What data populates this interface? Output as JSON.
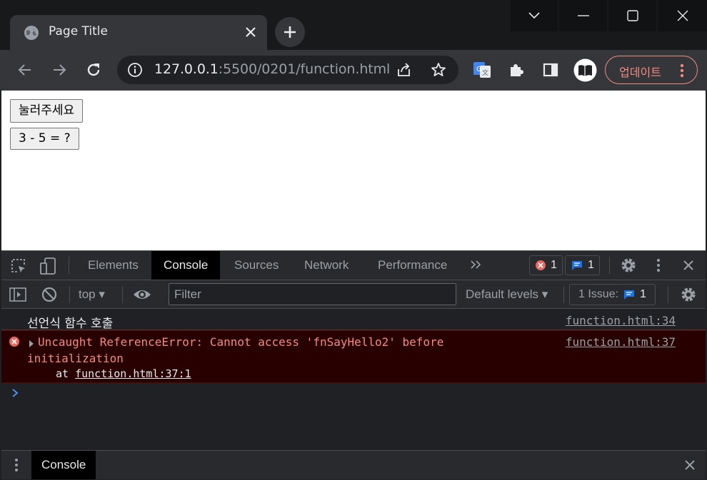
{
  "browser": {
    "tab_title": "Page Title",
    "url_host": "127.0.0.1",
    "url_rest": ":5500/0201/function.html",
    "update_label": "업데이트"
  },
  "page": {
    "button1_label": "눌러주세요",
    "button2_label": "3 - 5 = ?"
  },
  "devtools": {
    "tabs": [
      "Elements",
      "Console",
      "Sources",
      "Network",
      "Performance"
    ],
    "active_tab": "Console",
    "error_count": "1",
    "message_count": "1",
    "context": "top",
    "filter_placeholder": "Filter",
    "levels": "Default levels",
    "issues_label": "1 Issue:",
    "issues_count": "1",
    "console": {
      "log_text": "선언식 함수 호출",
      "log_source": "function.html:34",
      "error_line1": "Uncaught ReferenceError: Cannot access 'fnSayHello2' before",
      "error_line2": "initialization",
      "error_at": "at",
      "error_link": "function.html:37:1",
      "error_source": "function.html:37"
    },
    "drawer_tab": "Console"
  },
  "colors": {
    "error": "#f28b82",
    "accent_blue": "#1a73e8",
    "devtools_bg": "#202124"
  }
}
